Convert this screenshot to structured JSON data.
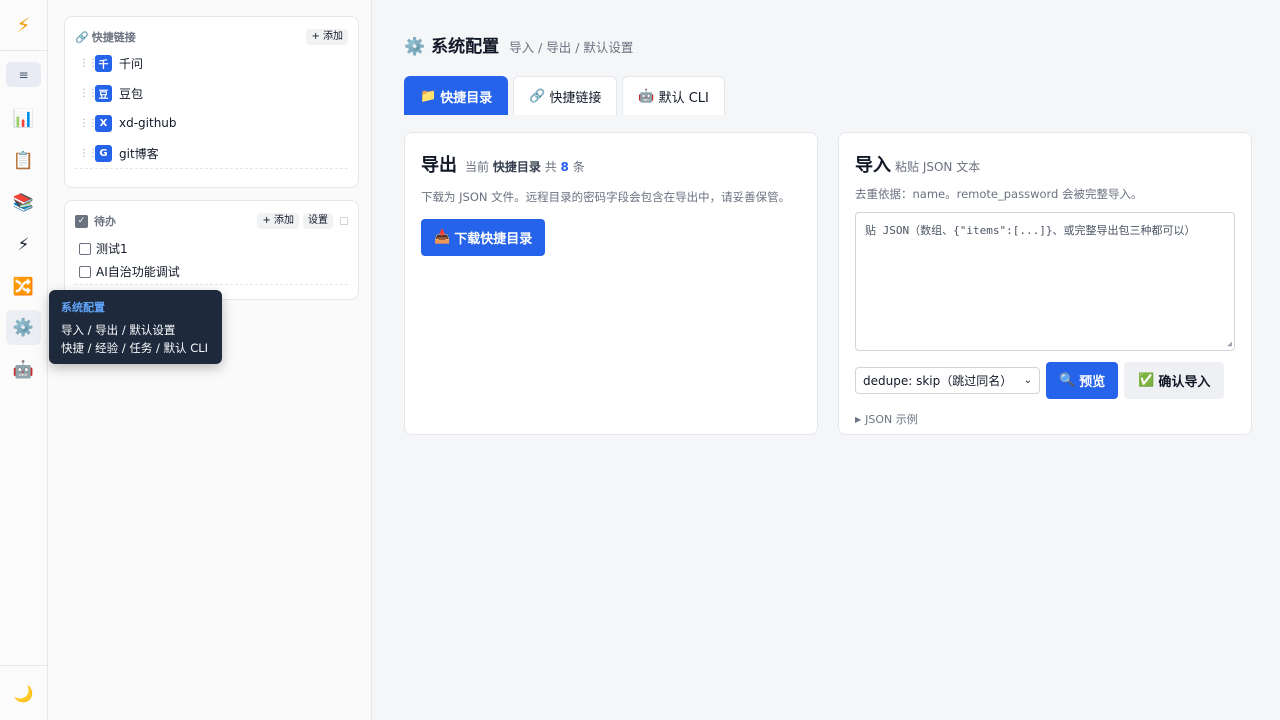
{
  "rail": {
    "logo": "⚡",
    "toggle": "≡",
    "icons": [
      "📊",
      "📋",
      "📚",
      "⚡",
      "🔀",
      "⚙️",
      "🤖"
    ],
    "theme_icon": "🌙"
  },
  "quick_links": {
    "icon": "🔗",
    "title": "快捷链接",
    "add_label": "+ 添加",
    "items": [
      {
        "badge": "千",
        "label": "千问"
      },
      {
        "badge": "豆",
        "label": "豆包"
      },
      {
        "badge": "X",
        "label": "xd-github"
      },
      {
        "badge": "G",
        "label": "git博客"
      }
    ]
  },
  "todo": {
    "title": "待办",
    "add_label": "+ 添加",
    "settings_label": "设置",
    "items": [
      {
        "label": "测试1"
      },
      {
        "label": "AI自治功能调试"
      }
    ]
  },
  "tooltip": {
    "title": "系统配置",
    "line1": "导入 / 导出 / 默认设置",
    "line2": "快捷 / 经验 / 任务 / 默认 CLI"
  },
  "header": {
    "icon": "⚙️",
    "title": "系统配置",
    "subtitle": "导入 / 导出 / 默认设置"
  },
  "tabs": [
    {
      "icon": "📁",
      "label": "快捷目录",
      "active": true
    },
    {
      "icon": "🔗",
      "label": "快捷链接",
      "active": false
    },
    {
      "icon": "🤖",
      "label": "默认 CLI",
      "active": false
    }
  ],
  "export": {
    "title": "导出",
    "meta_prefix": "当前",
    "meta_target": "快捷目录",
    "meta_mid": "共",
    "meta_count": "8",
    "meta_suffix": "条",
    "desc": "下载为 JSON 文件。远程目录的密码字段会包含在导出中，请妥善保管。",
    "download_icon": "📥",
    "download_label": "下载快捷目录"
  },
  "import": {
    "title": "导入",
    "subtitle": "粘贴 JSON 文本",
    "desc": "去重依据：name。remote_password 会被完整导入。",
    "placeholder": "贴 JSON（数组、{\"items\":[...]}、或完整导出包三种都可以）",
    "dedupe_value": "dedupe: skip（跳过同名）",
    "preview_icon": "🔍",
    "preview_label": "预览",
    "confirm_icon": "✅",
    "confirm_label": "确认导入",
    "example_label": "JSON 示例"
  }
}
